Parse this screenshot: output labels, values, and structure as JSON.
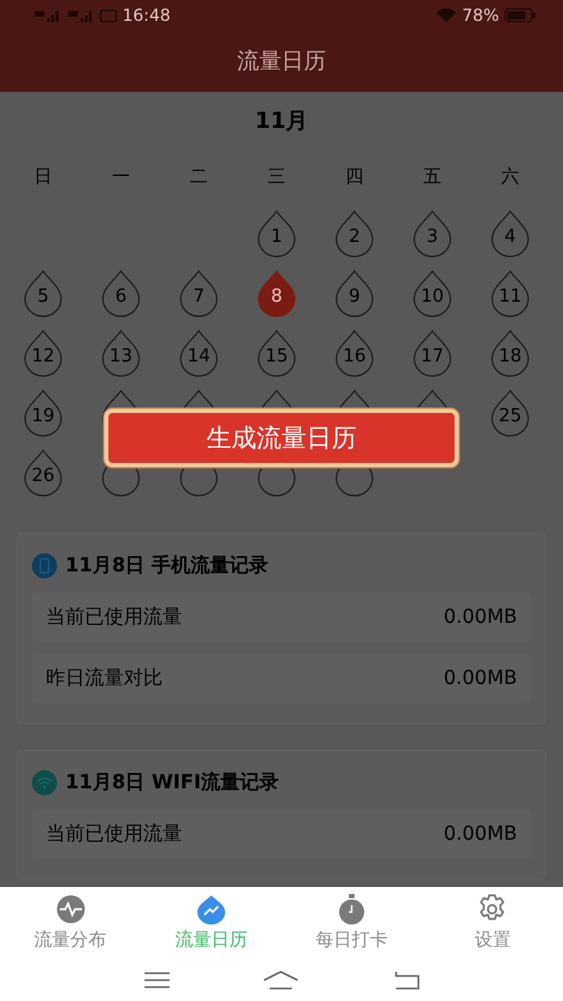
{
  "status_bar": {
    "time": "16:48",
    "battery": "78%"
  },
  "header": {
    "title": "流量日历"
  },
  "calendar": {
    "month": "11月",
    "weekdays": [
      "日",
      "一",
      "二",
      "三",
      "四",
      "五",
      "六"
    ],
    "days": [
      {
        "kind": "blank"
      },
      {
        "kind": "blank"
      },
      {
        "kind": "blank"
      },
      {
        "kind": "day",
        "label": "1",
        "selected": false
      },
      {
        "kind": "day",
        "label": "2",
        "selected": false
      },
      {
        "kind": "day",
        "label": "3",
        "selected": false
      },
      {
        "kind": "day",
        "label": "4",
        "selected": false
      },
      {
        "kind": "day",
        "label": "5",
        "selected": false
      },
      {
        "kind": "day",
        "label": "6",
        "selected": false
      },
      {
        "kind": "day",
        "label": "7",
        "selected": false
      },
      {
        "kind": "day",
        "label": "8",
        "selected": true
      },
      {
        "kind": "day",
        "label": "9",
        "selected": false
      },
      {
        "kind": "day",
        "label": "10",
        "selected": false
      },
      {
        "kind": "day",
        "label": "11",
        "selected": false
      },
      {
        "kind": "day",
        "label": "12",
        "selected": false
      },
      {
        "kind": "day",
        "label": "13",
        "selected": false
      },
      {
        "kind": "day",
        "label": "14",
        "selected": false
      },
      {
        "kind": "day",
        "label": "15",
        "selected": false
      },
      {
        "kind": "day",
        "label": "16",
        "selected": false
      },
      {
        "kind": "day",
        "label": "17",
        "selected": false
      },
      {
        "kind": "day",
        "label": "18",
        "selected": false
      },
      {
        "kind": "day",
        "label": "19",
        "selected": false
      },
      {
        "kind": "day",
        "selected": false
      },
      {
        "kind": "day",
        "selected": false
      },
      {
        "kind": "day",
        "selected": false
      },
      {
        "kind": "day",
        "selected": false
      },
      {
        "kind": "day",
        "selected": false
      },
      {
        "kind": "day",
        "label": "25",
        "selected": false
      },
      {
        "kind": "day",
        "label": "26",
        "selected": false
      },
      {
        "kind": "day",
        "selected": false
      },
      {
        "kind": "day",
        "selected": false
      },
      {
        "kind": "day",
        "selected": false
      },
      {
        "kind": "day",
        "selected": false
      }
    ]
  },
  "generate_button": {
    "label": "生成流量日历"
  },
  "records": [
    {
      "kind": "phone",
      "title": "11月8日 手机流量记录",
      "rows": [
        {
          "label": "当前已使用流量",
          "value": "0.00MB"
        },
        {
          "label": "昨日流量对比",
          "value": "0.00MB"
        }
      ]
    },
    {
      "kind": "wifi",
      "title": "11月8日 WIFI流量记录",
      "rows": [
        {
          "label": "当前已使用流量",
          "value": "0.00MB"
        }
      ]
    }
  ],
  "bottom_nav": [
    {
      "kind": "pulse",
      "label": "流量分布",
      "selected": false
    },
    {
      "kind": "chart",
      "label": "流量日历",
      "selected": true
    },
    {
      "kind": "stopwatch",
      "label": "每日打卡",
      "selected": false
    },
    {
      "kind": "gear",
      "label": "设置",
      "selected": false
    }
  ]
}
